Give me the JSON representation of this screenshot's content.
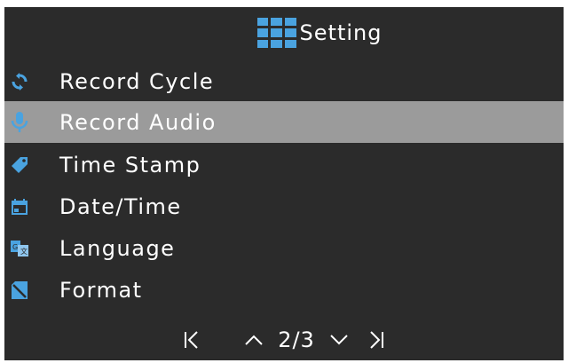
{
  "header": {
    "title": "Setting",
    "icon": "grid-menu-icon"
  },
  "menu": {
    "items": [
      {
        "label": "Record Cycle",
        "icon": "cycle-icon",
        "selected": false
      },
      {
        "label": "Record Audio",
        "icon": "microphone-icon",
        "selected": true
      },
      {
        "label": "Time Stamp",
        "icon": "tag-icon",
        "selected": false
      },
      {
        "label": "Date/Time",
        "icon": "calendar-icon",
        "selected": false
      },
      {
        "label": "Language",
        "icon": "language-icon",
        "selected": false
      },
      {
        "label": "Format",
        "icon": "sd-card-icon",
        "selected": false
      }
    ]
  },
  "footer": {
    "page_indicator": "2/3",
    "first_icon": "first-page-icon",
    "prev_icon": "page-up-icon",
    "next_icon": "page-down-icon",
    "last_icon": "last-page-icon"
  },
  "colors": {
    "background": "#2b2b2b",
    "selected_row": "#9b9b9b",
    "accent": "#4aa3e0",
    "text": "#ffffff"
  }
}
